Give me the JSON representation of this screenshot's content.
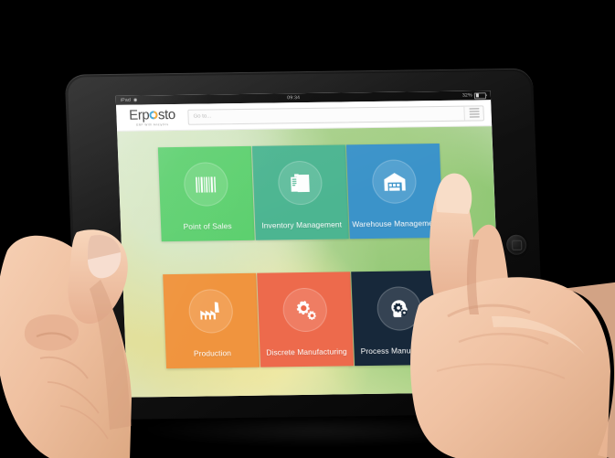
{
  "device": {
    "name": "tablet-ipad",
    "home_button": "home-button"
  },
  "status_bar": {
    "carrier": "iPad",
    "wifi_icon": "wifi-icon",
    "time": "09:34",
    "battery_text": "32%",
    "battery_icon": "battery-icon"
  },
  "app_header": {
    "logo": {
      "text_before": "Erp",
      "text_after": "sto",
      "circle_icon": "logo-circle-icon",
      "tagline": "ERP With Analytics",
      "accent_blue": "#2e9fd4",
      "accent_orange": "#f5a01e"
    },
    "search": {
      "placeholder": "Go to...",
      "value": ""
    },
    "menu_button": "hamburger-menu-icon"
  },
  "tiles": [
    {
      "id": "point-of-sales",
      "label": "Point of Sales",
      "icon": "barcode-icon",
      "color": "#5dd06f"
    },
    {
      "id": "inventory-management",
      "label": "Inventory Management",
      "icon": "folders-documents-icon",
      "color": "#4cb591"
    },
    {
      "id": "warehouse-management",
      "label": "Warehouse Management",
      "icon": "warehouse-icon",
      "color": "#3b93c9"
    },
    {
      "id": "production",
      "label": "Production",
      "icon": "factory-icon",
      "color": "#f0943e"
    },
    {
      "id": "discrete-manufacturing",
      "label": "Discrete Manufacturing",
      "icon": "gears-icon",
      "color": "#ed6a4c"
    },
    {
      "id": "process-manufacturing",
      "label": "Process Manufacturing",
      "icon": "head-gears-icon",
      "color": "#17283a"
    }
  ],
  "hands": {
    "left": "left-hand-holding-tablet",
    "right": "right-hand-pointing-finger",
    "pointing_at": "warehouse-management"
  }
}
